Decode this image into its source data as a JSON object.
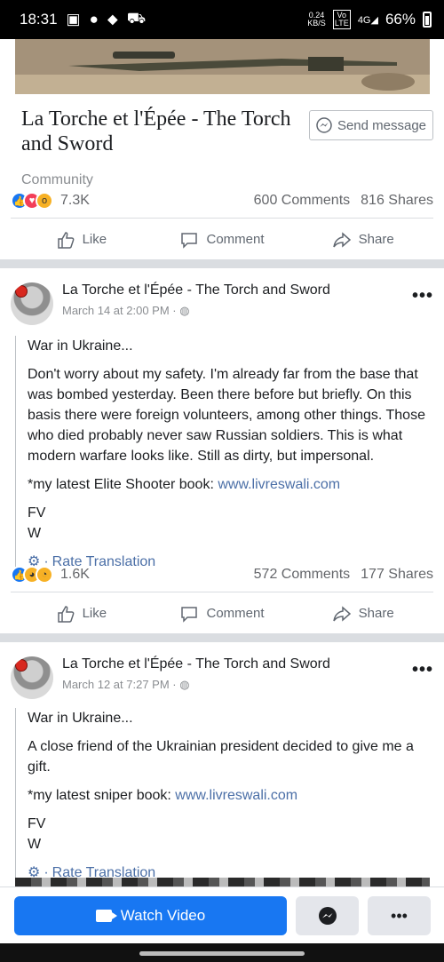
{
  "status_bar": {
    "time": "18:31",
    "net_speed": "0.24",
    "net_unit": "KB/S",
    "volte": "Vo LTE",
    "signal": "4G",
    "battery": "66%"
  },
  "page": {
    "title": "La Torche et l'Épée - The Torch and Sword",
    "type": "Community",
    "send_message_label": "Send message"
  },
  "page_stats": {
    "reactions": "7.3K",
    "comments": "600 Comments",
    "shares": "816 Shares"
  },
  "actions": {
    "like": "Like",
    "comment": "Comment",
    "share": "Share"
  },
  "posts": [
    {
      "author": "La Torche et l'Épée - The Torch and Sword",
      "date": "March 14 at 2:00 PM ·",
      "paragraphs": [
        "War in Ukraine...",
        "Don't worry about my safety. I'm already far from the base that was bombed yesterday. Been there before but briefly. On this basis there were foreign volunteers, among other things. Those who died probably never saw Russian soldiers. This is what modern warfare looks like. Still as dirty, but impersonal."
      ],
      "book_prefix": "*my latest Elite Shooter book: ",
      "book_link": "www.livreswali.com",
      "sign1": "FV",
      "sign2": "W",
      "rate": "Rate Translation",
      "reactions": "1.6K",
      "comments": "572 Comments",
      "shares": "177 Shares"
    },
    {
      "author": "La Torche et l'Épée - The Torch and Sword",
      "date": "March 12 at 7:27 PM ·",
      "paragraphs": [
        "War in Ukraine...",
        "A close friend of the Ukrainian president decided to give me a gift."
      ],
      "book_prefix": "*my latest sniper book: ",
      "book_link": "www.livreswali.com",
      "sign1": "FV",
      "sign2": "W",
      "rate": "Rate Translation"
    }
  ],
  "bottom_bar": {
    "watch_video": "Watch Video",
    "more": "•••"
  }
}
